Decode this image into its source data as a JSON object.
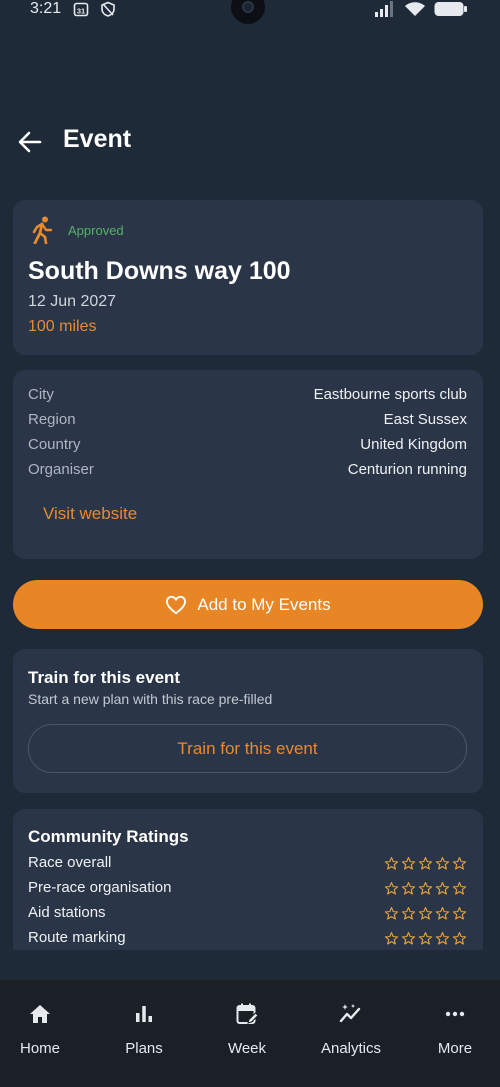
{
  "status": {
    "time": "3:21",
    "calendar_badge": "31"
  },
  "header": {
    "title": "Event"
  },
  "event": {
    "status": "Approved",
    "name": "South Downs way 100",
    "date": "12 Jun 2027",
    "distance": "100 miles"
  },
  "details": {
    "rows": [
      {
        "label": "City",
        "value": "Eastbourne sports club"
      },
      {
        "label": "Region",
        "value": "East Sussex"
      },
      {
        "label": "Country",
        "value": "United Kingdom"
      },
      {
        "label": "Organiser",
        "value": "Centurion running"
      }
    ],
    "visit_label": "Visit website"
  },
  "add_button": {
    "label": "Add to My Events"
  },
  "train": {
    "heading": "Train for this event",
    "subtitle": "Start a new plan with this race pre-filled",
    "button_label": "Train for this event"
  },
  "ratings": {
    "heading": "Community Ratings",
    "items": [
      {
        "label": "Race overall",
        "stars": 0
      },
      {
        "label": "Pre-race organisation",
        "stars": 0
      },
      {
        "label": "Aid stations",
        "stars": 0
      },
      {
        "label": "Route marking",
        "stars": 0
      }
    ]
  },
  "nav": {
    "items": [
      {
        "label": "Home",
        "icon": "home-icon"
      },
      {
        "label": "Plans",
        "icon": "bar-chart-icon"
      },
      {
        "label": "Week",
        "icon": "calendar-edit-icon"
      },
      {
        "label": "Analytics",
        "icon": "trend-sparkle-icon"
      },
      {
        "label": "More",
        "icon": "more-horizontal-icon"
      }
    ]
  },
  "colors": {
    "background": "#1f2a38",
    "card": "#2a3547",
    "accent": "#e88626",
    "approved": "#58b06a",
    "nav_bg": "#1b1f26"
  }
}
